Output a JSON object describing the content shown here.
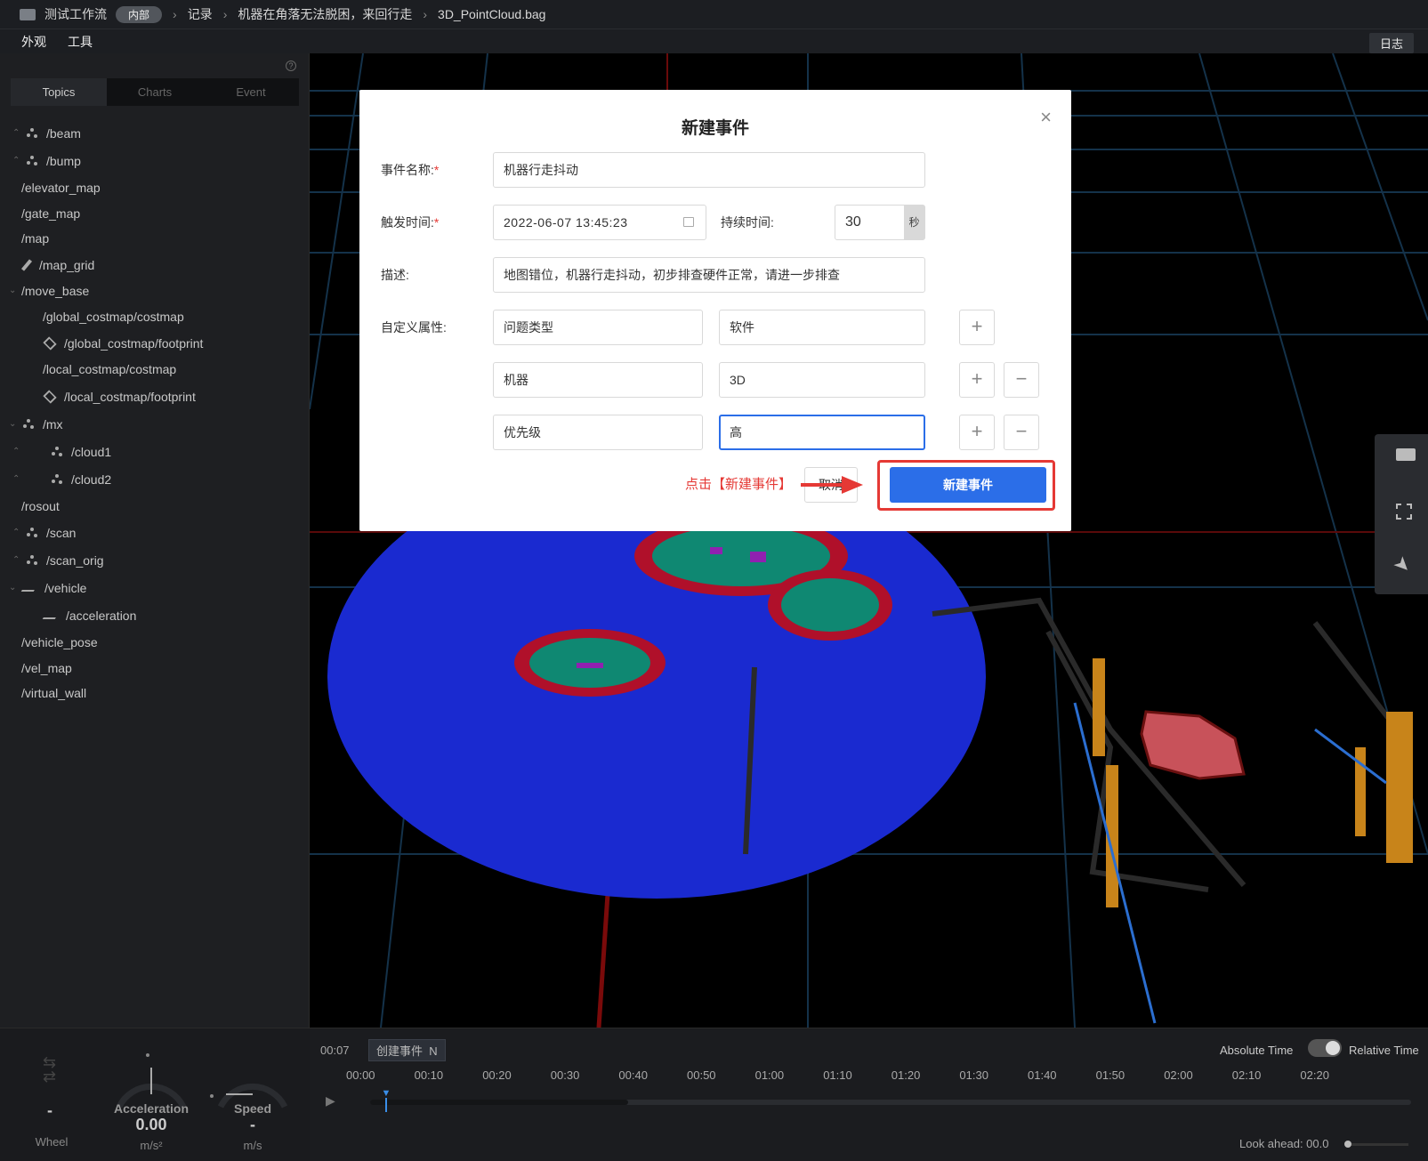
{
  "topbar": {
    "workspace": "测试工作流",
    "badge": "内部",
    "crumb1": "记录",
    "crumb2": "机器在角落无法脱困，来回行走",
    "crumb3": "3D_PointCloud.bag"
  },
  "menubar": {
    "appearance": "外观",
    "tools": "工具",
    "log": "日志"
  },
  "sidebar": {
    "tabs": [
      "Topics",
      "Charts",
      "Event"
    ],
    "topics": [
      "/beam",
      "/bump",
      "/elevator_map",
      "/gate_map",
      "/map",
      "/map_grid",
      "/move_base",
      "/global_costmap/costmap",
      "/global_costmap/footprint",
      "/local_costmap/costmap",
      "/local_costmap/footprint",
      "/mx",
      "/cloud1",
      "/cloud2",
      "/rosout",
      "/scan",
      "/scan_orig",
      "/vehicle",
      "/acceleration",
      "/vehicle_pose",
      "/vel_map",
      "/virtual_wall"
    ]
  },
  "gauges": {
    "wheel_value": "-",
    "wheel_label": "Wheel",
    "acc_title": "Acceleration",
    "acc_value": "0.00",
    "acc_unit": "m/s²",
    "speed_title": "Speed",
    "speed_value": "-",
    "speed_unit": "m/s"
  },
  "timeline": {
    "current": "00:07",
    "create_event": "创建事件",
    "shortcut": "N",
    "absolute": "Absolute Time",
    "relative": "Relative Time",
    "ticks": [
      "00:00",
      "00:10",
      "00:20",
      "00:30",
      "00:40",
      "00:50",
      "01:00",
      "01:10",
      "01:20",
      "01:30",
      "01:40",
      "01:50",
      "02:00",
      "02:10",
      "02:20"
    ],
    "look_ahead": "Look ahead: 00.0",
    "progress": 0.015
  },
  "modal": {
    "title": "新建事件",
    "name_label": "事件名称:",
    "name_value": "机器行走抖动",
    "time_label": "触发时间:",
    "time_value": "2022-06-07 13:45:23",
    "duration_label": "持续时间:",
    "duration_value": "30",
    "duration_unit": "秒",
    "desc_label": "描述:",
    "desc_value": "地图错位，机器行走抖动，初步排查硬件正常，请进一步排查",
    "attr_label": "自定义属性:",
    "attrs": [
      {
        "key": "问题类型",
        "value": "软件"
      },
      {
        "key": "机器",
        "value": "3D"
      },
      {
        "key": "优先级",
        "value": "高"
      }
    ],
    "cancel": "取消",
    "submit": "新建事件",
    "annotation": "点击【新建事件】"
  },
  "colors": {
    "accent": "#2b6ee8",
    "annotation": "#e53935"
  }
}
